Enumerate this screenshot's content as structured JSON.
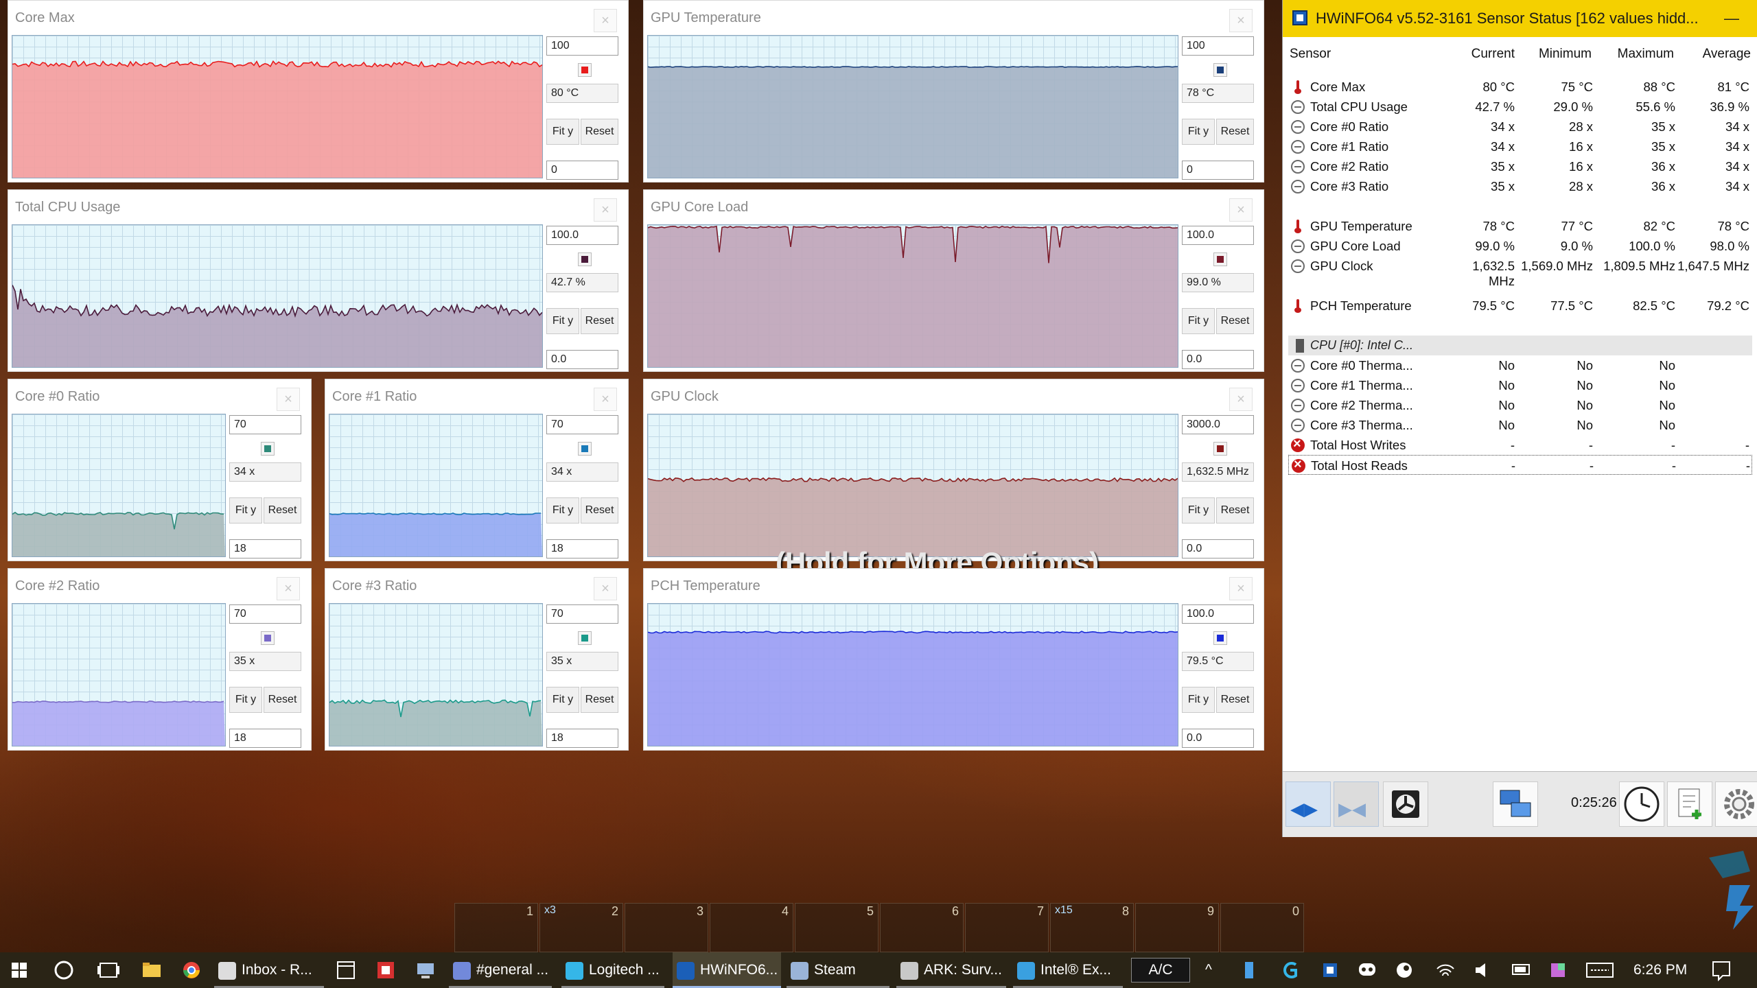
{
  "graphs": [
    {
      "id": "g0",
      "title": "Core Max",
      "max": "100",
      "current": "80 °C",
      "min": "0",
      "fit": "Fit y",
      "reset": "Reset",
      "color": "#e81c1c",
      "fill": "#f59c9c",
      "level": 0.8,
      "noise": 0.02
    },
    {
      "id": "g1",
      "title": "GPU Temperature",
      "max": "100",
      "current": "78 °C",
      "min": "0",
      "fit": "Fit y",
      "reset": "Reset",
      "color": "#1a3f7a",
      "fill": "#a4b3c4",
      "level": 0.78,
      "noise": 0.003
    },
    {
      "id": "g2",
      "title": "Total CPU Usage",
      "max": "100.0",
      "current": "42.7 %",
      "min": "0.0",
      "fit": "Fit y",
      "reset": "Reset",
      "color": "#4a1a3a",
      "fill": "#b3a4bc",
      "level": 0.4,
      "noise": 0.04
    },
    {
      "id": "g3",
      "title": "GPU Core Load",
      "max": "100.0",
      "current": "99.0 %",
      "min": "0.0",
      "fit": "Fit y",
      "reset": "Reset",
      "color": "#7a1a2a",
      "fill": "#c0a4b8",
      "level": 0.985,
      "noise": 0.006
    },
    {
      "id": "g4",
      "title": "Core #0 Ratio",
      "max": "70",
      "current": "34 x",
      "min": "18",
      "fit": "Fit y",
      "reset": "Reset",
      "color": "#2e8a7a",
      "fill": "#a9b9b9",
      "level": 0.3,
      "noise": 0.01
    },
    {
      "id": "g5",
      "title": "Core #1 Ratio",
      "max": "70",
      "current": "34 x",
      "min": "18",
      "fit": "Fit y",
      "reset": "Reset",
      "color": "#1a7ab8",
      "fill": "#93a8f2",
      "level": 0.3,
      "noise": 0.005
    },
    {
      "id": "g6",
      "title": "GPU Clock",
      "max": "3000.0",
      "current": "1,632.5 MHz",
      "min": "0.0",
      "fit": "Fit y",
      "reset": "Reset",
      "color": "#8a1a1a",
      "fill": "#c6aaaa",
      "level": 0.54,
      "noise": 0.012
    },
    {
      "id": "g7",
      "title": "Core #2 Ratio",
      "max": "70",
      "current": "35 x",
      "min": "18",
      "fit": "Fit y",
      "reset": "Reset",
      "color": "#7a6ac8",
      "fill": "#aeaaf4",
      "level": 0.31,
      "noise": 0.005
    },
    {
      "id": "g8",
      "title": "Core #3 Ratio",
      "max": "70",
      "current": "35 x",
      "min": "18",
      "fit": "Fit y",
      "reset": "Reset",
      "color": "#1a9a8a",
      "fill": "#a4bcbc",
      "level": 0.31,
      "noise": 0.012
    },
    {
      "id": "g9",
      "title": "PCH Temperature",
      "max": "100.0",
      "current": "79.5 °C",
      "min": "0.0",
      "fit": "Fit y",
      "reset": "Reset",
      "color": "#1a2ad8",
      "fill": "#9a9cf4",
      "level": 0.8,
      "noise": 0.006
    }
  ],
  "hwinfo": {
    "title": "HWiNFO64 v5.52-3161 Sensor Status [162 values hidd...",
    "headers": {
      "sensor": "Sensor",
      "current": "Current",
      "minimum": "Minimum",
      "maximum": "Maximum",
      "average": "Average"
    },
    "rows": [
      {
        "icon": "therm",
        "name": "Core Max",
        "cur": "80 °C",
        "min": "75 °C",
        "max": "88 °C",
        "avg": "81 °C"
      },
      {
        "icon": "gauge",
        "name": "Total CPU Usage",
        "cur": "42.7 %",
        "min": "29.0 %",
        "max": "55.6 %",
        "avg": "36.9 %"
      },
      {
        "icon": "gauge",
        "name": "Core #0 Ratio",
        "cur": "34 x",
        "min": "28 x",
        "max": "35 x",
        "avg": "34 x"
      },
      {
        "icon": "gauge",
        "name": "Core #1 Ratio",
        "cur": "34 x",
        "min": "16 x",
        "max": "35 x",
        "avg": "34 x"
      },
      {
        "icon": "gauge",
        "name": "Core #2 Ratio",
        "cur": "35 x",
        "min": "16 x",
        "max": "36 x",
        "avg": "34 x"
      },
      {
        "icon": "gauge",
        "name": "Core #3 Ratio",
        "cur": "35 x",
        "min": "28 x",
        "max": "36 x",
        "avg": "34 x"
      },
      {
        "gap": true
      },
      {
        "icon": "therm",
        "name": "GPU Temperature",
        "cur": "78 °C",
        "min": "77 °C",
        "max": "82 °C",
        "avg": "78 °C"
      },
      {
        "icon": "gauge",
        "name": "GPU Core Load",
        "cur": "99.0 %",
        "min": "9.0 %",
        "max": "100.0 %",
        "avg": "98.0 %"
      },
      {
        "icon": "gauge",
        "name": "GPU Clock",
        "cur": "1,632.5 MHz",
        "min": "1,569.0 MHz",
        "max": "1,809.5 MHz",
        "avg": "1,647.5 MHz"
      },
      {
        "gap": true
      },
      {
        "icon": "therm",
        "name": "PCH Temperature",
        "cur": "79.5 °C",
        "min": "77.5 °C",
        "max": "82.5 °C",
        "avg": "79.2 °C"
      },
      {
        "gap": true
      },
      {
        "group": true,
        "name": "CPU [#0]: Intel C..."
      },
      {
        "icon": "gauge",
        "name": "Core #0 Therma...",
        "cur": "No",
        "min": "No",
        "max": "No",
        "avg": ""
      },
      {
        "icon": "gauge",
        "name": "Core #1 Therma...",
        "cur": "No",
        "min": "No",
        "max": "No",
        "avg": ""
      },
      {
        "icon": "gauge",
        "name": "Core #2 Therma...",
        "cur": "No",
        "min": "No",
        "max": "No",
        "avg": ""
      },
      {
        "icon": "gauge",
        "name": "Core #3 Therma...",
        "cur": "No",
        "min": "No",
        "max": "No",
        "avg": ""
      },
      {
        "icon": "err",
        "name": "Total Host Writes",
        "cur": "-",
        "min": "-",
        "max": "-",
        "avg": "-"
      },
      {
        "icon": "err",
        "name": "Total Host Reads",
        "cur": "-",
        "min": "-",
        "max": "-",
        "avg": "-",
        "selected": true
      }
    ],
    "elapsed": "0:25:26"
  },
  "game": {
    "overlay_text": "(Hold for More Options)",
    "hotbar": [
      {
        "n": "1",
        "q": ""
      },
      {
        "n": "2",
        "q": "x3"
      },
      {
        "n": "3",
        "q": ""
      },
      {
        "n": "4",
        "q": ""
      },
      {
        "n": "5",
        "q": ""
      },
      {
        "n": "6",
        "q": ""
      },
      {
        "n": "7",
        "q": ""
      },
      {
        "n": "8",
        "q": "x15"
      },
      {
        "n": "9",
        "q": ""
      },
      {
        "n": "0",
        "q": ""
      }
    ]
  },
  "taskbar": {
    "items": [
      {
        "name": "mail",
        "label": "Inbox - R...",
        "color": "#dddddd",
        "state": "open"
      },
      {
        "name": "discord",
        "label": "#general ...",
        "color": "#7289da",
        "state": "open"
      },
      {
        "name": "logitech",
        "label": "Logitech ...",
        "color": "#35b6e8",
        "state": "open"
      },
      {
        "name": "hwinfo",
        "label": "HWiNFO6...",
        "color": "#1b5fb8",
        "state": "active"
      },
      {
        "name": "steam",
        "label": "Steam",
        "color": "#9ab4d8",
        "state": "open"
      },
      {
        "name": "ark",
        "label": "ARK: Surv...",
        "color": "#c8c8c8",
        "state": "open"
      },
      {
        "name": "intel",
        "label": "Intel® Ex...",
        "color": "#3aa0e0",
        "state": "open"
      }
    ],
    "ac_label": "A/C",
    "clock": "6:26 PM"
  }
}
